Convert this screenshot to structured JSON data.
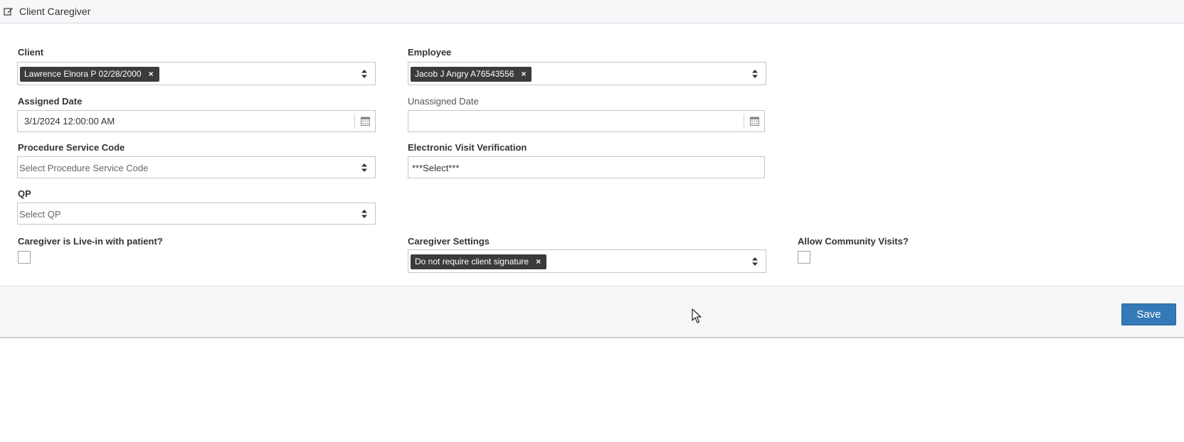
{
  "header": {
    "title": "Client Caregiver",
    "icon": "edit-icon"
  },
  "form": {
    "client": {
      "label": "Client",
      "selected_tag": "Lawrence Elnora P 02/28/2000",
      "remove_glyph": "×"
    },
    "employee": {
      "label": "Employee",
      "selected_tag": "Jacob J Angry A76543556",
      "remove_glyph": "×"
    },
    "assigned_date": {
      "label": "Assigned Date",
      "value": "3/1/2024 12:00:00 AM"
    },
    "unassigned_date": {
      "label": "Unassigned Date",
      "value": ""
    },
    "procedure_service_code": {
      "label": "Procedure Service Code",
      "placeholder": "Select Procedure Service Code"
    },
    "evv": {
      "label": "Electronic Visit Verification",
      "value": "***Select***"
    },
    "qp": {
      "label": "QP",
      "placeholder": "Select QP"
    },
    "live_in": {
      "label": "Caregiver is Live-in with patient?",
      "checked": false
    },
    "caregiver_settings": {
      "label": "Caregiver Settings",
      "selected_tag": "Do not require client signature",
      "remove_glyph": "×"
    },
    "community_visits": {
      "label": "Allow Community Visits?",
      "checked": false
    }
  },
  "footer": {
    "save_label": "Save"
  },
  "colors": {
    "primary_button": "#347ab8",
    "tag_background": "#3b3b3b",
    "header_background": "#f7f7f9"
  }
}
